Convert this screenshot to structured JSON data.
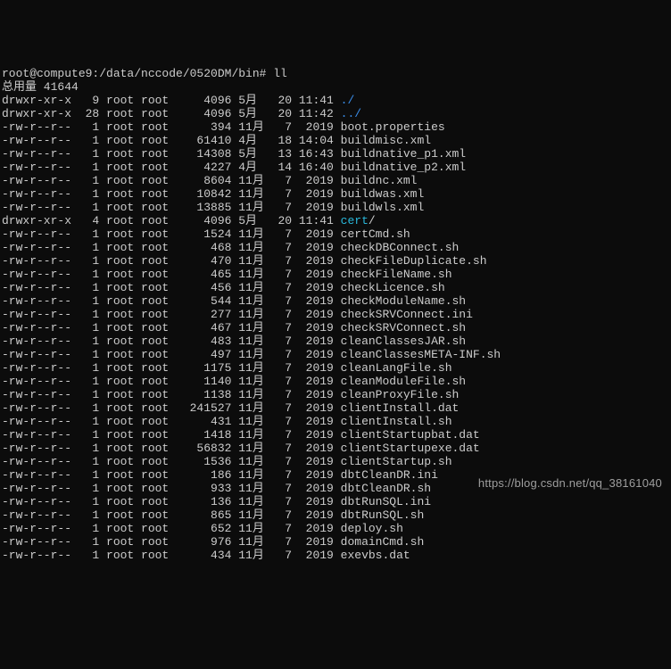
{
  "prompt_prev_tail": "",
  "prompt": "root@compute9:/data/nccode/0520DM/bin# ",
  "command": "ll",
  "total_label": "总用量 41644",
  "watermark": "https://blog.csdn.net/qq_38161040",
  "rows": [
    {
      "perms": "drwxr-xr-x",
      "links": "9",
      "owner": "root",
      "group": "root",
      "size": "4096",
      "month": "5月",
      "day": "20",
      "time": "11:41",
      "name": "./",
      "cls": "dir"
    },
    {
      "perms": "drwxr-xr-x",
      "links": "28",
      "owner": "root",
      "group": "root",
      "size": "4096",
      "month": "5月",
      "day": "20",
      "time": "11:42",
      "name": "../",
      "cls": "dir"
    },
    {
      "perms": "-rw-r--r--",
      "links": "1",
      "owner": "root",
      "group": "root",
      "size": "394",
      "month": "11月",
      "day": "7",
      "time": "2019",
      "name": "boot.properties",
      "cls": ""
    },
    {
      "perms": "-rw-r--r--",
      "links": "1",
      "owner": "root",
      "group": "root",
      "size": "61410",
      "month": "4月",
      "day": "18",
      "time": "14:04",
      "name": "buildmisc.xml",
      "cls": ""
    },
    {
      "perms": "-rw-r--r--",
      "links": "1",
      "owner": "root",
      "group": "root",
      "size": "14308",
      "month": "5月",
      "day": "13",
      "time": "16:43",
      "name": "buildnative_p1.xml",
      "cls": ""
    },
    {
      "perms": "-rw-r--r--",
      "links": "1",
      "owner": "root",
      "group": "root",
      "size": "4227",
      "month": "4月",
      "day": "14",
      "time": "16:40",
      "name": "buildnative_p2.xml",
      "cls": ""
    },
    {
      "perms": "-rw-r--r--",
      "links": "1",
      "owner": "root",
      "group": "root",
      "size": "8604",
      "month": "11月",
      "day": "7",
      "time": "2019",
      "name": "buildnc.xml",
      "cls": ""
    },
    {
      "perms": "-rw-r--r--",
      "links": "1",
      "owner": "root",
      "group": "root",
      "size": "10842",
      "month": "11月",
      "day": "7",
      "time": "2019",
      "name": "buildwas.xml",
      "cls": ""
    },
    {
      "perms": "-rw-r--r--",
      "links": "1",
      "owner": "root",
      "group": "root",
      "size": "13885",
      "month": "11月",
      "day": "7",
      "time": "2019",
      "name": "buildwls.xml",
      "cls": ""
    },
    {
      "perms": "drwxr-xr-x",
      "links": "4",
      "owner": "root",
      "group": "root",
      "size": "4096",
      "month": "5月",
      "day": "20",
      "time": "11:41",
      "name": "cert",
      "suffix": "/",
      "cls": "link-cyan"
    },
    {
      "perms": "-rw-r--r--",
      "links": "1",
      "owner": "root",
      "group": "root",
      "size": "1524",
      "month": "11月",
      "day": "7",
      "time": "2019",
      "name": "certCmd.sh",
      "cls": ""
    },
    {
      "perms": "-rw-r--r--",
      "links": "1",
      "owner": "root",
      "group": "root",
      "size": "468",
      "month": "11月",
      "day": "7",
      "time": "2019",
      "name": "checkDBConnect.sh",
      "cls": ""
    },
    {
      "perms": "-rw-r--r--",
      "links": "1",
      "owner": "root",
      "group": "root",
      "size": "470",
      "month": "11月",
      "day": "7",
      "time": "2019",
      "name": "checkFileDuplicate.sh",
      "cls": ""
    },
    {
      "perms": "-rw-r--r--",
      "links": "1",
      "owner": "root",
      "group": "root",
      "size": "465",
      "month": "11月",
      "day": "7",
      "time": "2019",
      "name": "checkFileName.sh",
      "cls": ""
    },
    {
      "perms": "-rw-r--r--",
      "links": "1",
      "owner": "root",
      "group": "root",
      "size": "456",
      "month": "11月",
      "day": "7",
      "time": "2019",
      "name": "checkLicence.sh",
      "cls": ""
    },
    {
      "perms": "-rw-r--r--",
      "links": "1",
      "owner": "root",
      "group": "root",
      "size": "544",
      "month": "11月",
      "day": "7",
      "time": "2019",
      "name": "checkModuleName.sh",
      "cls": ""
    },
    {
      "perms": "-rw-r--r--",
      "links": "1",
      "owner": "root",
      "group": "root",
      "size": "277",
      "month": "11月",
      "day": "7",
      "time": "2019",
      "name": "checkSRVConnect.ini",
      "cls": ""
    },
    {
      "perms": "-rw-r--r--",
      "links": "1",
      "owner": "root",
      "group": "root",
      "size": "467",
      "month": "11月",
      "day": "7",
      "time": "2019",
      "name": "checkSRVConnect.sh",
      "cls": ""
    },
    {
      "perms": "-rw-r--r--",
      "links": "1",
      "owner": "root",
      "group": "root",
      "size": "483",
      "month": "11月",
      "day": "7",
      "time": "2019",
      "name": "cleanClassesJAR.sh",
      "cls": ""
    },
    {
      "perms": "-rw-r--r--",
      "links": "1",
      "owner": "root",
      "group": "root",
      "size": "497",
      "month": "11月",
      "day": "7",
      "time": "2019",
      "name": "cleanClassesMETA-INF.sh",
      "cls": ""
    },
    {
      "perms": "-rw-r--r--",
      "links": "1",
      "owner": "root",
      "group": "root",
      "size": "1175",
      "month": "11月",
      "day": "7",
      "time": "2019",
      "name": "cleanLangFile.sh",
      "cls": ""
    },
    {
      "perms": "-rw-r--r--",
      "links": "1",
      "owner": "root",
      "group": "root",
      "size": "1140",
      "month": "11月",
      "day": "7",
      "time": "2019",
      "name": "cleanModuleFile.sh",
      "cls": ""
    },
    {
      "perms": "-rw-r--r--",
      "links": "1",
      "owner": "root",
      "group": "root",
      "size": "1138",
      "month": "11月",
      "day": "7",
      "time": "2019",
      "name": "cleanProxyFile.sh",
      "cls": ""
    },
    {
      "perms": "-rw-r--r--",
      "links": "1",
      "owner": "root",
      "group": "root",
      "size": "241527",
      "month": "11月",
      "day": "7",
      "time": "2019",
      "name": "clientInstall.dat",
      "cls": ""
    },
    {
      "perms": "-rw-r--r--",
      "links": "1",
      "owner": "root",
      "group": "root",
      "size": "431",
      "month": "11月",
      "day": "7",
      "time": "2019",
      "name": "clientInstall.sh",
      "cls": ""
    },
    {
      "perms": "-rw-r--r--",
      "links": "1",
      "owner": "root",
      "group": "root",
      "size": "1418",
      "month": "11月",
      "day": "7",
      "time": "2019",
      "name": "clientStartupbat.dat",
      "cls": ""
    },
    {
      "perms": "-rw-r--r--",
      "links": "1",
      "owner": "root",
      "group": "root",
      "size": "56832",
      "month": "11月",
      "day": "7",
      "time": "2019",
      "name": "clientStartupexe.dat",
      "cls": ""
    },
    {
      "perms": "-rw-r--r--",
      "links": "1",
      "owner": "root",
      "group": "root",
      "size": "1536",
      "month": "11月",
      "day": "7",
      "time": "2019",
      "name": "clientStartup.sh",
      "cls": ""
    },
    {
      "perms": "-rw-r--r--",
      "links": "1",
      "owner": "root",
      "group": "root",
      "size": "186",
      "month": "11月",
      "day": "7",
      "time": "2019",
      "name": "dbtCleanDR.ini",
      "cls": ""
    },
    {
      "perms": "-rw-r--r--",
      "links": "1",
      "owner": "root",
      "group": "root",
      "size": "933",
      "month": "11月",
      "day": "7",
      "time": "2019",
      "name": "dbtCleanDR.sh",
      "cls": ""
    },
    {
      "perms": "-rw-r--r--",
      "links": "1",
      "owner": "root",
      "group": "root",
      "size": "136",
      "month": "11月",
      "day": "7",
      "time": "2019",
      "name": "dbtRunSQL.ini",
      "cls": ""
    },
    {
      "perms": "-rw-r--r--",
      "links": "1",
      "owner": "root",
      "group": "root",
      "size": "865",
      "month": "11月",
      "day": "7",
      "time": "2019",
      "name": "dbtRunSQL.sh",
      "cls": ""
    },
    {
      "perms": "-rw-r--r--",
      "links": "1",
      "owner": "root",
      "group": "root",
      "size": "652",
      "month": "11月",
      "day": "7",
      "time": "2019",
      "name": "deploy.sh",
      "cls": ""
    },
    {
      "perms": "-rw-r--r--",
      "links": "1",
      "owner": "root",
      "group": "root",
      "size": "976",
      "month": "11月",
      "day": "7",
      "time": "2019",
      "name": "domainCmd.sh",
      "cls": ""
    },
    {
      "perms": "-rw-r--r--",
      "links": "1",
      "owner": "root",
      "group": "root",
      "size": "434",
      "month": "11月",
      "day": "7",
      "time": "2019",
      "name": "exevbs.dat",
      "cls": ""
    }
  ]
}
